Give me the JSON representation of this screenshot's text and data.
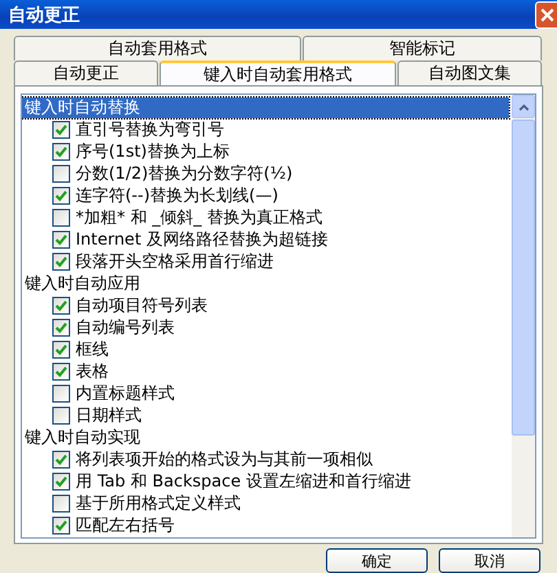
{
  "window": {
    "title": "自动更正"
  },
  "tabs": [
    [
      {
        "label": "自动套用格式",
        "selected": false
      },
      {
        "label": "智能标记",
        "selected": false
      }
    ],
    [
      {
        "label": "自动更正",
        "selected": false
      },
      {
        "label": "键入时自动套用格式",
        "selected": true
      },
      {
        "label": "自动图文集",
        "selected": false
      }
    ]
  ],
  "groups": [
    {
      "label": "键入时自动替换",
      "selected": true,
      "items": [
        {
          "label": "直引号替换为弯引号",
          "checked": true
        },
        {
          "label": "序号(1st)替换为上标",
          "checked": true
        },
        {
          "label": "分数(1/2)替换为分数字符(½)",
          "checked": false
        },
        {
          "label": "连字符(--)替换为长划线(—)",
          "checked": true
        },
        {
          "label": "*加粗* 和 _倾斜_ 替换为真正格式",
          "checked": false
        },
        {
          "label": "Internet 及网络路径替换为超链接",
          "checked": true
        },
        {
          "label": "段落开头空格采用首行缩进",
          "checked": true
        }
      ]
    },
    {
      "label": "键入时自动应用",
      "selected": false,
      "items": [
        {
          "label": "自动项目符号列表",
          "checked": true
        },
        {
          "label": "自动编号列表",
          "checked": true
        },
        {
          "label": "框线",
          "checked": true
        },
        {
          "label": "表格",
          "checked": true
        },
        {
          "label": "内置标题样式",
          "checked": false
        },
        {
          "label": "日期样式",
          "checked": false
        }
      ]
    },
    {
      "label": "键入时自动实现",
      "selected": false,
      "items": [
        {
          "label": "将列表项开始的格式设为与其前一项相似",
          "checked": true
        },
        {
          "label": "用 Tab 和 Backspace 设置左缩进和首行缩进",
          "checked": true
        },
        {
          "label": "基于所用格式定义样式",
          "checked": false
        },
        {
          "label": "匹配左右括号",
          "checked": true
        }
      ]
    }
  ],
  "buttons": [
    "确定",
    "取消"
  ]
}
